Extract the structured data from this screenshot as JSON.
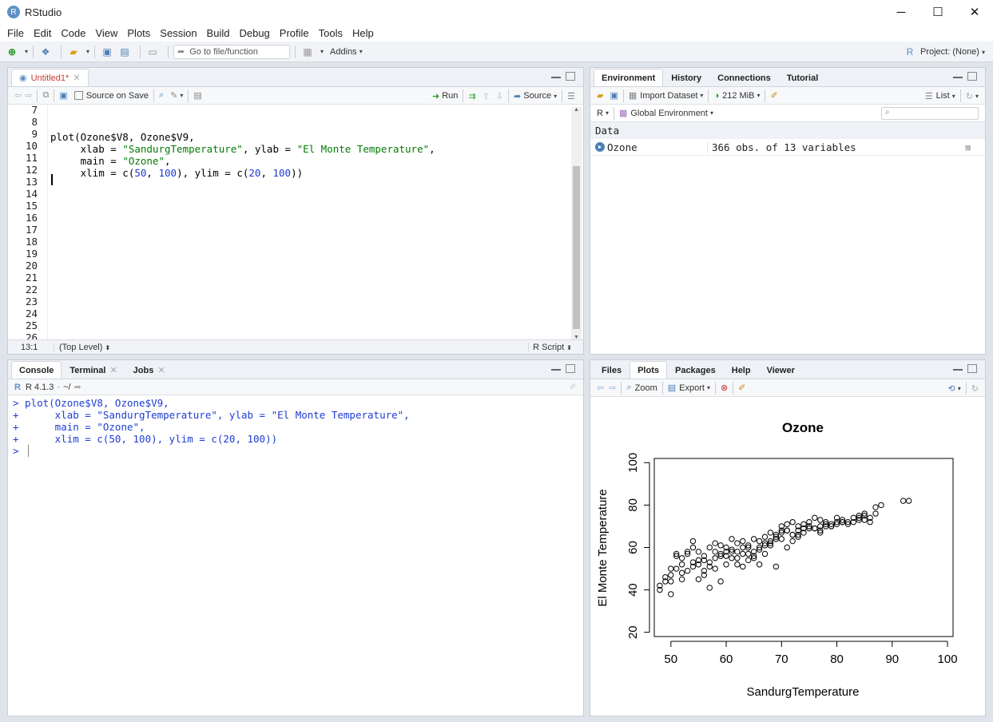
{
  "window": {
    "app_icon": "R",
    "title": "RStudio",
    "minimize": "─",
    "maximize": "☐",
    "close": "✕"
  },
  "menu": [
    "File",
    "Edit",
    "Code",
    "View",
    "Plots",
    "Session",
    "Build",
    "Debug",
    "Profile",
    "Tools",
    "Help"
  ],
  "toolbar": {
    "goto_placeholder": "Go to file/function",
    "addins": "Addins",
    "project": "Project: (None)"
  },
  "editor": {
    "tab": "Untitled1*",
    "source_on_save": "Source on Save",
    "run": "Run",
    "source": "Source",
    "line_numbers": [
      "7",
      "8",
      "9",
      "10",
      "11",
      "12",
      "13",
      "14",
      "15",
      "16",
      "17",
      "18",
      "19",
      "20",
      "21",
      "22",
      "23",
      "24",
      "25",
      "26"
    ],
    "code": {
      "l9a": "plot(Ozone$V8, Ozone$V9,",
      "l10a": "     xlab = ",
      "l10s1": "\"SandurgTemperature\"",
      "l10b": ", ylab = ",
      "l10s2": "\"El Monte Temperature\"",
      "l10c": ",",
      "l11a": "     main = ",
      "l11s": "\"Ozone\"",
      "l11b": ",",
      "l12a": "     xlim = c(",
      "l12n1": "50",
      "l12b": ", ",
      "l12n2": "100",
      "l12c": "), ylim = c(",
      "l12n3": "20",
      "l12d": ", ",
      "l12n4": "100",
      "l12e": "))"
    },
    "cursor_pos": "13:1",
    "scope": "(Top Level)",
    "file_type": "R Script"
  },
  "console": {
    "tabs": [
      "Console",
      "Terminal",
      "Jobs"
    ],
    "r_version": "R 4.1.3",
    "path": "~/",
    "lines": [
      "> plot(Ozone$V8, Ozone$V9,",
      "+      xlab = \"SandurgTemperature\", ylab = \"El Monte Temperature\",",
      "+      main = \"Ozone\",",
      "+      xlim = c(50, 100), ylim = c(20, 100))",
      "> "
    ]
  },
  "environment": {
    "tabs": [
      "Environment",
      "History",
      "Connections",
      "Tutorial"
    ],
    "import_dataset": "Import Dataset",
    "memory": "212 MiB",
    "view_mode": "List",
    "lang": "R",
    "scope": "Global Environment",
    "section": "Data",
    "rows": [
      {
        "name": "Ozone",
        "value": "366 obs. of 13 variables"
      }
    ]
  },
  "files": {
    "tabs": [
      "Files",
      "Plots",
      "Packages",
      "Help",
      "Viewer"
    ],
    "zoom": "Zoom",
    "export": "Export"
  },
  "chart_data": {
    "type": "scatter",
    "title": "Ozone",
    "xlabel": "SandurgTemperature",
    "ylabel": "El Monte Temperature",
    "xlim": [
      50,
      100
    ],
    "ylim": [
      20,
      100
    ],
    "xticks": [
      50,
      60,
      70,
      80,
      90,
      100
    ],
    "yticks": [
      20,
      40,
      60,
      80,
      100
    ],
    "x": [
      48,
      49,
      50,
      51,
      51,
      52,
      52,
      53,
      53,
      54,
      54,
      55,
      55,
      56,
      56,
      57,
      57,
      58,
      58,
      59,
      59,
      60,
      60,
      61,
      61,
      62,
      62,
      63,
      63,
      64,
      64,
      65,
      65,
      66,
      66,
      67,
      67,
      68,
      68,
      69,
      69,
      70,
      70,
      71,
      71,
      72,
      72,
      73,
      73,
      74,
      74,
      75,
      75,
      76,
      76,
      77,
      77,
      78,
      78,
      79,
      79,
      80,
      80,
      81,
      81,
      82,
      83,
      84,
      84,
      85,
      85,
      86,
      87,
      87,
      88,
      92,
      93,
      49,
      50,
      52,
      54,
      56,
      58,
      60,
      62,
      64,
      66,
      68,
      70,
      72,
      55,
      57,
      59,
      61,
      63,
      65,
      67,
      69,
      71,
      73,
      75,
      77,
      53,
      51,
      50,
      56,
      58,
      60,
      62,
      64,
      66,
      68,
      70,
      72,
      74,
      76,
      78,
      80,
      82,
      84,
      86,
      52,
      55,
      57,
      59,
      61,
      63,
      65,
      67,
      69,
      71,
      73,
      75,
      77,
      79,
      81,
      83,
      85,
      54,
      48,
      50
    ],
    "y": [
      42,
      46,
      47,
      50,
      56,
      45,
      55,
      49,
      57,
      53,
      63,
      52,
      58,
      49,
      56,
      53,
      60,
      55,
      62,
      57,
      61,
      58,
      60,
      55,
      64,
      58,
      62,
      57,
      63,
      60,
      61,
      58,
      64,
      60,
      63,
      61,
      65,
      63,
      67,
      64,
      66,
      67,
      70,
      68,
      71,
      66,
      72,
      68,
      70,
      69,
      71,
      70,
      72,
      69,
      74,
      70,
      73,
      71,
      72,
      70,
      71,
      72,
      74,
      72,
      73,
      71,
      72,
      74,
      75,
      73,
      76,
      74,
      79,
      76,
      80,
      82,
      82,
      44,
      50,
      52,
      60,
      54,
      58,
      56,
      52,
      54,
      52,
      61,
      68,
      63,
      45,
      41,
      44,
      59,
      51,
      55,
      57,
      51,
      60,
      65,
      69,
      67,
      58,
      57,
      44,
      47,
      50,
      52,
      55,
      57,
      59,
      62,
      64,
      66,
      67,
      69,
      70,
      71,
      72,
      73,
      72,
      48,
      54,
      51,
      56,
      58,
      60,
      56,
      62,
      65,
      68,
      66,
      70,
      68,
      70,
      72,
      74,
      75,
      51,
      40,
      38
    ]
  }
}
